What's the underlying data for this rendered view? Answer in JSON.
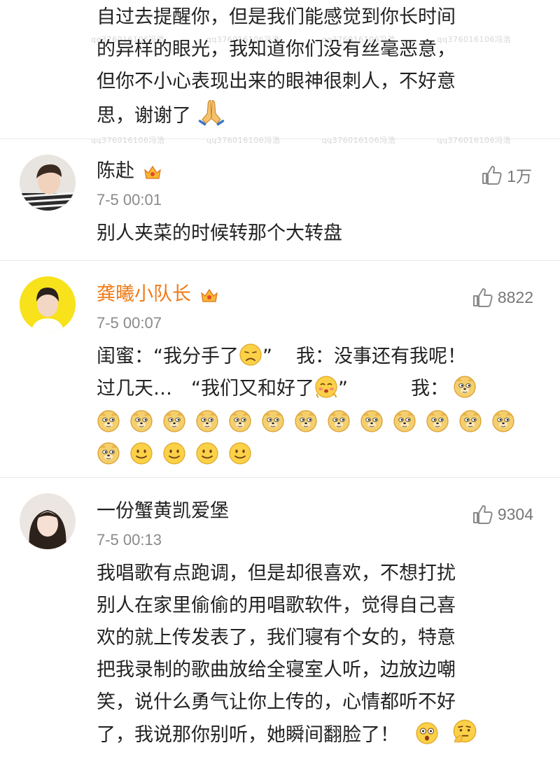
{
  "top_comment": {
    "lines": [
      "自过去提醒你，但是我们能感觉到你长时间",
      "的异样的眼光，我知道你们没有丝毫恶意，",
      "但你不小心表现出来的眼神很刺人，不好意",
      "思，谢谢了"
    ]
  },
  "watermark": "qq3760161​06冯浩",
  "comments": [
    {
      "name": "陈赴",
      "time": "7-5 00:01",
      "likes": "1万",
      "text": [
        "别人夹菜的时候转那个大转盘"
      ]
    },
    {
      "name": "龚曦小队长",
      "time": "7-5 00:07",
      "likes": "8822",
      "text": [
        "闺蜜：“我分手了",
        "”",
        "我：没事还有我呢！",
        "过几天…　“我们又和好了",
        "”",
        "我："
      ]
    },
    {
      "name": "一份蟹黄凯爱堡",
      "time": "7-5 00:13",
      "likes": "9304",
      "text": [
        "我唱歌有点跑调，但是却很喜欢，不想打扰",
        "别人在家里偷偷的用唱歌软件，觉得自己喜",
        "欢的就上传发表了，我们寝有个女的，特意",
        "把我录制的歌曲放给全寝室人听，边放边嘲",
        "笑，说什么勇气让你上传的，心情都听不好",
        "了，我说那你别听，她瞬间翻脸了！"
      ]
    }
  ],
  "icons": {
    "like": "thumbs-up-icon",
    "vip": "vip-crown-icon",
    "pray": "praying-hands-icon",
    "sad": "sad-face-icon",
    "blush": "blushing-face-icon",
    "doge": "doge-icon",
    "smile": "smile-icon",
    "shock": "shocked-face-icon",
    "think": "thinking-face-icon"
  },
  "colors": {
    "username_highlight": "#f07a17",
    "meta": "#8a8a8a",
    "divider": "#e9e9e9"
  }
}
